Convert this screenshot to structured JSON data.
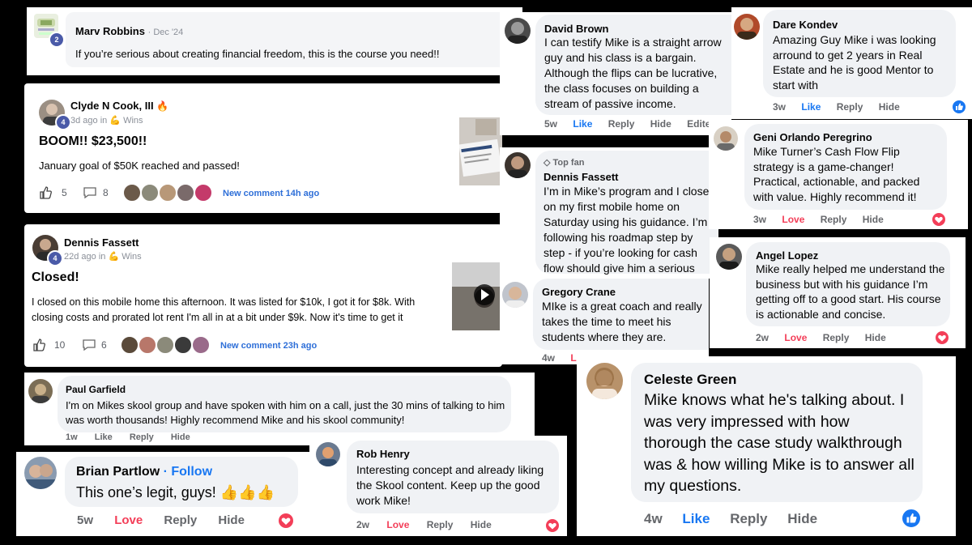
{
  "marv": {
    "badge": "2",
    "name": "Marv Robbins",
    "date": "Dec '24",
    "text": "If you’re serious about creating financial freedom, this is the course you need!!"
  },
  "clyde": {
    "name": "Clyde N Cook, III",
    "meta": "3d ago in",
    "category": "Wins",
    "badge": "4",
    "title": "BOOM!! $23,500!!",
    "body": "January goal of $50K reached and passed!",
    "likes": "5",
    "comments": "8",
    "new_comment": "New comment 14h ago",
    "fire_emoji": "🔥",
    "strong_emoji": "💪"
  },
  "dennis_sk": {
    "name": "Dennis Fassett",
    "meta": "22d ago in",
    "category": "Wins",
    "badge": "4",
    "title": "Closed!",
    "body": "I closed on this mobile home this afternoon. It was listed for $10k, I got it for $8k. With closing costs and prorated lot rent I'm all in at a bit under $9k. Now it's time to get it",
    "likes": "10",
    "comments": "6",
    "new_comment": "New comment 23h ago"
  },
  "paul": {
    "name": "Paul Garfield",
    "text": "I'm on Mikes skool group and have spoken with him on a call, just the 30 mins of talking to him was worth thousands! Highly recommend Mike and his skool community!",
    "time": "1w",
    "like": "Like",
    "reply": "Reply",
    "hide": "Hide"
  },
  "brian": {
    "name": "Brian Partlow",
    "follow": "· Follow",
    "text": "This one’s legit, guys! 👍👍👍",
    "time": "5w",
    "love": "Love",
    "reply": "Reply",
    "hide": "Hide"
  },
  "rob": {
    "name": "Rob Henry",
    "text": "Interesting concept and already liking the Skool content. Keep up the good work Mike!",
    "time": "2w",
    "love": "Love",
    "reply": "Reply",
    "hide": "Hide"
  },
  "david": {
    "name": "David Brown",
    "text": "I can testify Mike is a straight arrow guy and his class is a bargain. Although the flips can be lucrative, the class focuses on building a stream of passive income.",
    "time": "5w",
    "like": "Like",
    "reply": "Reply",
    "hide": "Hide",
    "edited": "Edited"
  },
  "dennis_fb": {
    "top_fan": "Top fan",
    "name": "Dennis Fassett",
    "text": "I’m in Mike’s program and I closed on my first mobile home on Saturday using his guidance. I’m following his roadmap step by step - if you’re looking for cash flow should give him a serious look."
  },
  "gregory": {
    "name": "Gregory Crane",
    "text": "MIke is a great coach and really takes the time to meet his students where they are.",
    "time": "4w",
    "extra": "L"
  },
  "dare": {
    "name": "Dare Kondev",
    "text": "Amazing Guy Mike i was looking arround to get 2 years in Real Estate and he is good Mentor to start with",
    "time": "3w",
    "like": "Like",
    "reply": "Reply",
    "hide": "Hide"
  },
  "geni": {
    "name": "Geni Orlando Peregrino",
    "text": "Mike Turner’s Cash Flow Flip strategy is a game-changer! Practical, actionable, and packed with value. Highly recommend it!",
    "time": "3w",
    "love": "Love",
    "reply": "Reply",
    "hide": "Hide"
  },
  "angel": {
    "name": "Angel Lopez",
    "text": "Mike really helped me understand the business but with his guidance I’m getting off to a good start. His course is actionable and concise.",
    "time": "2w",
    "love": "Love",
    "reply": "Reply",
    "hide": "Hide"
  },
  "celeste": {
    "name": "Celeste Green",
    "text": "Mike knows what he's talking about. I was very impressed with how thorough the case study walkthrough was & how willing Mike is to answer all my questions.",
    "time": "4w",
    "like": "Like",
    "reply": "Reply",
    "hide": "Hide"
  },
  "colors": {
    "love": "#f33e58",
    "like": "#1877f2",
    "skool_blue": "#2e6fd8"
  }
}
